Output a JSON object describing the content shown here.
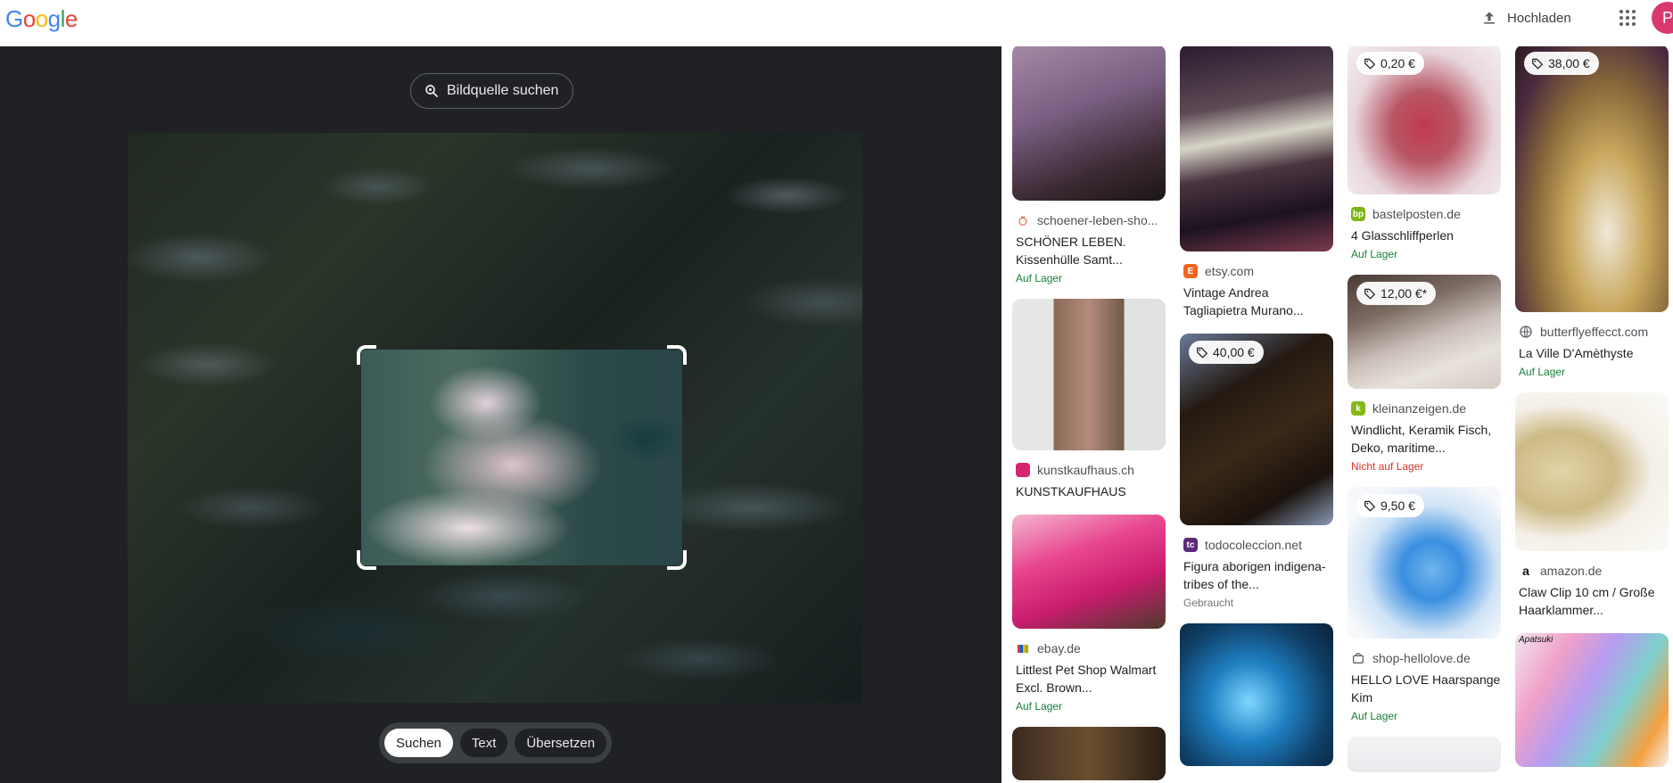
{
  "header": {
    "logo_letters": [
      {
        "ch": "G",
        "color": "#4285f4"
      },
      {
        "ch": "o",
        "color": "#ea4335"
      },
      {
        "ch": "o",
        "color": "#fbbc05"
      },
      {
        "ch": "g",
        "color": "#4285f4"
      },
      {
        "ch": "l",
        "color": "#34a853"
      },
      {
        "ch": "e",
        "color": "#ea4335"
      }
    ],
    "upload_label": "Hochladen",
    "avatar_letter": "P"
  },
  "lens": {
    "source_button_label": "Bildquelle suchen",
    "modes": [
      {
        "label": "Suchen",
        "active": true
      },
      {
        "label": "Text",
        "active": false
      },
      {
        "label": "Übersetzen",
        "active": false
      }
    ]
  },
  "results": {
    "columns": [
      [
        {
          "thumb_h": 175,
          "thumb_bg": "linear-gradient(160deg,#a58aa6 0%,#7a5f82 40%,#3b2a33 75%,#1c1614 100%)",
          "price": null,
          "fav_icon": "strawberry-icon",
          "fav_color": "#e37b5a",
          "fav_text": "",
          "source": "schoener-leben-sho...",
          "title": "SCHÖNER LEBEN. Kissenhülle Samt...",
          "stock": "Auf Lager",
          "stock_class": "ok"
        },
        {
          "thumb_h": 170,
          "thumb_bg": "linear-gradient(90deg,#e6e8e6 0%,#e6e8e6 27%,#8a6a58 27%,#b58a7a 50%,#6e5a4a 73%,#dfe2df 73%,#dfe2df 100%)",
          "price": null,
          "fav_icon": "square-icon",
          "fav_color": "#d6266f",
          "fav_text": "",
          "source": "kunstkaufhaus.ch",
          "title": "KUNSTKAUFHAUS",
          "stock": "",
          "stock_class": "ok"
        },
        {
          "thumb_h": 128,
          "thumb_bg": "linear-gradient(160deg,#f4b6cf 0%,#e8468f 35%,#c81c6d 65%,#4d3b2b 100%)",
          "price": null,
          "fav_icon": "ebay-icon",
          "fav_color": "#86b817",
          "fav_text": "",
          "source": "ebay.de",
          "title": "Littlest Pet Shop Walmart Excl. Brown...",
          "stock": "Auf Lager",
          "stock_class": "ok"
        },
        {
          "thumb_h": 60,
          "thumb_bg": "linear-gradient(90deg,#3b2a1f 0%,#6b5030 50%,#2a1d15 100%)",
          "price": null,
          "fav_icon": "",
          "fav_color": "",
          "fav_text": "",
          "source": "",
          "title": "",
          "stock": "",
          "stock_class": "ok"
        }
      ],
      [
        {
          "thumb_h": 232,
          "thumb_bg": "linear-gradient(170deg,#2a1a2e 0%,#5d4a55 30%,#d8d6c8 45%,#4a3540 60%,#1d1220 80%,#7a3b4e 100%)",
          "price": null,
          "fav_icon": "etsy-icon",
          "fav_color": "#f1641e",
          "fav_text": "E",
          "source": "etsy.com",
          "title": "Vintage Andrea Tagliapietra Murano...",
          "stock": "",
          "stock_class": "ok"
        },
        {
          "thumb_h": 215,
          "thumb_bg": "linear-gradient(150deg,#6a7a9a 0%,#241a12 30%,#3a2818 55%,#1a120c 80%,#8a9bb8 100%)",
          "price": "40,00 €",
          "fav_icon": "todocoleccion-icon",
          "fav_color": "#5c2a7a",
          "fav_text": "tc",
          "source": "todocoleccion.net",
          "title": "Figura aborigen indigena- tribes of the...",
          "stock": "Gebraucht",
          "stock_class": "used"
        },
        {
          "thumb_h": 160,
          "thumb_bg": "radial-gradient(circle at 45% 55%,#7fd6ff 0%,#1f7fc2 35%,#0f3f66 70%,#0a2238 100%)",
          "price": null,
          "fav_icon": "",
          "fav_color": "",
          "fav_text": "",
          "source": "",
          "title": "",
          "stock": "",
          "stock_class": "ok"
        }
      ],
      [
        {
          "thumb_h": 168,
          "thumb_bg": "radial-gradient(ellipse at 50% 55%,#c23a4e 0%,#b85664 30%,#e8d6dc 65%,#f4f0f2 100%)",
          "price": "0,20 €",
          "fav_icon": "bastelposten-icon",
          "fav_color": "#7cb518",
          "fav_text": "bp",
          "source": "bastelposten.de",
          "title": "4 Glasschliffperlen",
          "stock": "Auf Lager",
          "stock_class": "ok"
        },
        {
          "thumb_h": 128,
          "thumb_bg": "linear-gradient(160deg,#4a3a36 0%,#7a6a62 30%,#c9bfb8 55%,#e8e2dc 75%,#d4ccc4 100%)",
          "price": "12,00 €*",
          "fav_icon": "kleinanzeigen-icon",
          "fav_color": "#86b817",
          "fav_text": "k",
          "source": "kleinanzeigen.de",
          "title": "Windlicht, Keramik Fisch, Deko, maritime...",
          "stock": "Nicht auf Lager",
          "stock_class": "no"
        },
        {
          "thumb_h": 170,
          "thumb_bg": "radial-gradient(ellipse at 55% 55%,#6fb4ec 0%,#3a8fe0 25%,#cfe3f6 55%,#f6f8fb 80%)",
          "price": "9,50 €",
          "fav_icon": "shop-icon",
          "fav_color": "#9aa0a6",
          "fav_text": "",
          "source": "shop-hellolove.de",
          "title": "HELLO LOVE Haarspange Kim",
          "stock": "Auf Lager",
          "stock_class": "ok"
        },
        {
          "thumb_h": 40,
          "thumb_bg": "linear-gradient(180deg,#f1f3f4 0%,#e8eaed 100%)",
          "price": null,
          "fav_icon": "",
          "fav_color": "",
          "fav_text": "",
          "source": "",
          "title": "",
          "stock": "",
          "stock_class": "ok"
        }
      ],
      [
        {
          "thumb_h": 300,
          "thumb_bg": "radial-gradient(ellipse at 60% 70%,#f0e8d8 0%,#c9a85e 30%,#8a6a3a 55%,#4a2a3e 80%,#2a1a22 100%)",
          "price": "38,00 €",
          "fav_icon": "globe-icon",
          "fav_color": "#5f6368",
          "fav_text": "",
          "source": "butterflyeffecct.com",
          "title": "La Ville D'Amèthyste",
          "stock": "Auf Lager",
          "stock_class": "ok"
        },
        {
          "thumb_h": 178,
          "thumb_bg": "radial-gradient(ellipse at 30% 50%,#e2d4a8 0%,#cdb985 35%,#f4f0e8 60%,#fbfaf6 100%)",
          "price": null,
          "fav_icon": "amazon-icon",
          "fav_color": "#111",
          "fav_text": "a",
          "source": "amazon.de",
          "title": "Claw Clip 10 cm / Große Haarklammer...",
          "stock": "",
          "stock_class": "ok"
        },
        {
          "thumb_h": 150,
          "thumb_bg": "linear-gradient(120deg,#f3e6f0 0%,#f0a0c8 25%,#b59cf0 45%,#7fd0d0 65%,#f5a040 85%,#f5f0f2 100%)",
          "price": null,
          "fav_icon": "",
          "fav_color": "",
          "fav_text": "",
          "source": "",
          "title": "",
          "stock": "",
          "stock_class": "ok",
          "overlay_text": "Apatsuki"
        }
      ]
    ]
  }
}
